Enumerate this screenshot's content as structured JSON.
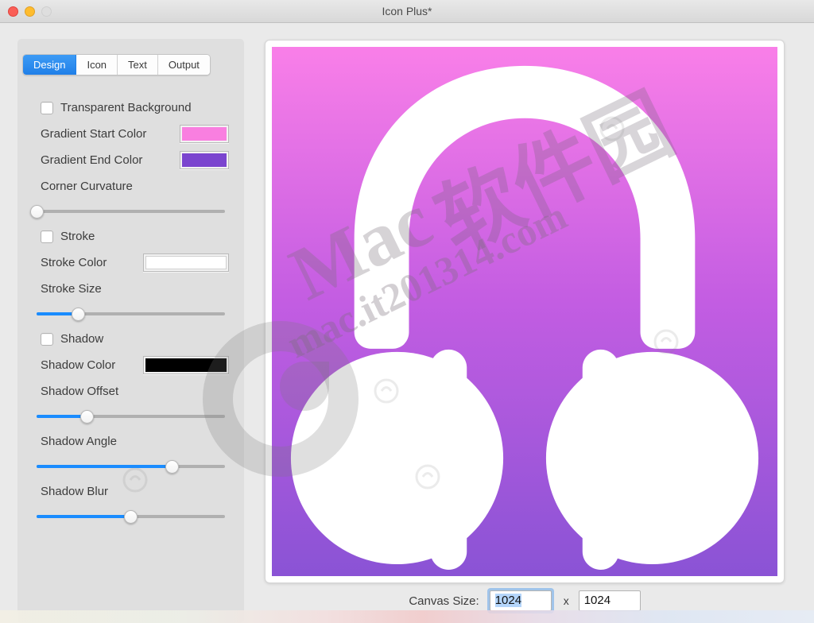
{
  "window": {
    "title": "Icon Plus*",
    "traffic_lights": [
      "close",
      "minimize",
      "zoom"
    ]
  },
  "tabs": [
    {
      "label": "Design",
      "active": true
    },
    {
      "label": "Icon",
      "active": false
    },
    {
      "label": "Text",
      "active": false
    },
    {
      "label": "Output",
      "active": false
    }
  ],
  "design_panel": {
    "transparent_background": {
      "label": "Transparent Background",
      "checked": false
    },
    "gradient_start": {
      "label": "Gradient Start Color",
      "color": "#f97fe0"
    },
    "gradient_end": {
      "label": "Gradient End Color",
      "color": "#7b45cf"
    },
    "corner_curvature": {
      "label": "Corner Curvature",
      "value": 0
    },
    "stroke": {
      "label": "Stroke",
      "checked": false
    },
    "stroke_color": {
      "label": "Stroke Color",
      "color": "#ffffff"
    },
    "stroke_size": {
      "label": "Stroke Size",
      "value": 22
    },
    "shadow": {
      "label": "Shadow",
      "checked": false
    },
    "shadow_color": {
      "label": "Shadow Color",
      "color": "#000000"
    },
    "shadow_offset": {
      "label": "Shadow Offset",
      "value": 27
    },
    "shadow_angle": {
      "label": "Shadow Angle",
      "value": 72
    },
    "shadow_blur": {
      "label": "Shadow Blur",
      "value": 50
    }
  },
  "canvas": {
    "gradient_top": "#f97fe8",
    "gradient_bottom": "#8a53d5",
    "icon": "headphones-icon",
    "icon_color": "#ffffff"
  },
  "bottom_bar": {
    "canvas_size_label": "Canvas Size:",
    "width_value": "1024",
    "separator": "x",
    "height_value": "1024"
  },
  "watermark": {
    "brand": "Mac",
    "site": "mac.it201314.com",
    "cn_text": "软件园"
  }
}
